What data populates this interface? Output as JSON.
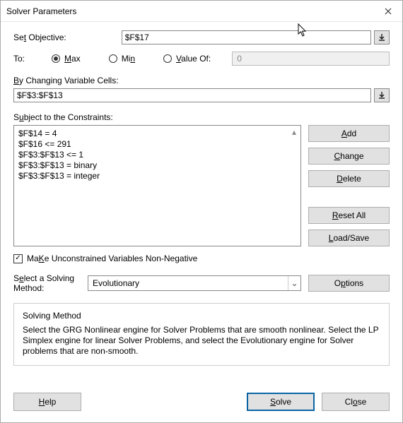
{
  "title": "Solver Parameters",
  "labels": {
    "set_objective_pre": "Se",
    "set_objective_u": "t",
    "set_objective_post": " Objective:",
    "to": "To:",
    "max_u": "M",
    "max_post": "ax",
    "min_pre": "Mi",
    "min_u": "n",
    "valueof_u": "V",
    "valueof_post": "alue Of:",
    "by_u": "B",
    "by_post": "y Changing Variable Cells:",
    "subject_pre": "S",
    "subject_u": "u",
    "subject_post": "bject to the Constraints:",
    "make_u": "K",
    "make_pre": "Ma",
    "make_post": "e Unconstrained Variables Non-Negative",
    "select_pre": "S",
    "select_u": "e",
    "select_post": "lect a Solving Method:",
    "solving_method": "Solving Method",
    "desc": "Select the GRG Nonlinear engine for Solver Problems that are smooth nonlinear. Select the LP Simplex engine for linear Solver Problems, and select the Evolutionary engine for Solver problems that are non-smooth."
  },
  "inputs": {
    "objective": "$F$17",
    "value_of": "0",
    "changing_cells": "$F$3:$F$13",
    "method": "Evolutionary"
  },
  "radio_selected": "max",
  "checkbox_checked": true,
  "constraints": [
    "$F$14 = 4",
    "$F$16 <= 291",
    "$F$3:$F$13 <= 1",
    "$F$3:$F$13 = binary",
    "$F$3:$F$13 = integer"
  ],
  "buttons": {
    "add_u": "A",
    "add_post": "dd",
    "change_u": "C",
    "change_post": "hange",
    "delete_u": "D",
    "delete_post": "elete",
    "reset_u": "R",
    "reset_post": "eset All",
    "load_u": "L",
    "load_post": "oad/Save",
    "options_pre": "O",
    "options_u": "p",
    "options_post": "tions",
    "help_u": "H",
    "help_post": "elp",
    "solve_u": "S",
    "solve_post": "olve",
    "close_pre": "Cl",
    "close_u": "o",
    "close_post": "se"
  }
}
